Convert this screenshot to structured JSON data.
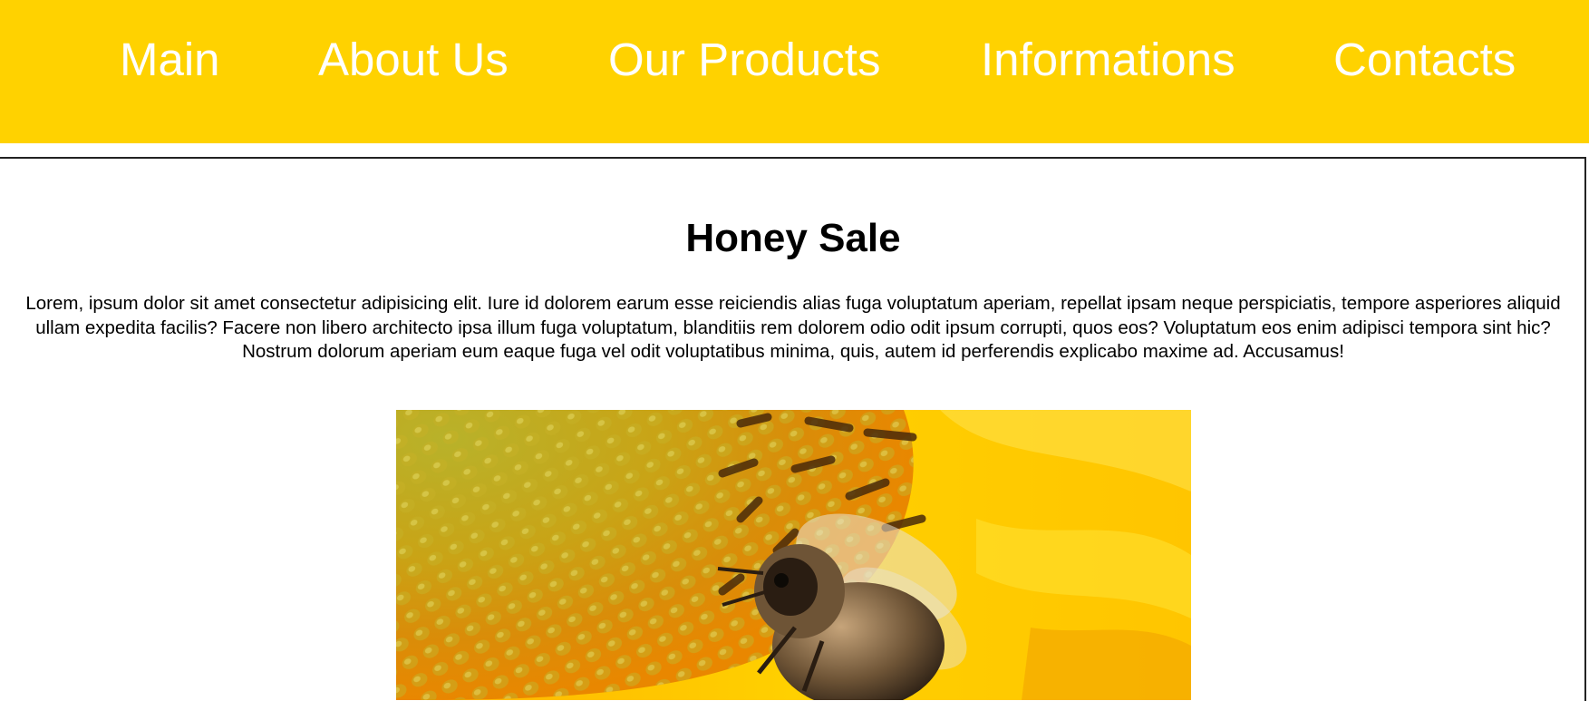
{
  "nav": {
    "items": [
      {
        "label": "Main"
      },
      {
        "label": "About Us"
      },
      {
        "label": "Our Products"
      },
      {
        "label": "Informations"
      },
      {
        "label": "Contacts"
      }
    ]
  },
  "main": {
    "title": "Honey Sale",
    "intro": "Lorem, ipsum dolor sit amet consectetur adipisicing elit. Iure id dolorem earum esse reiciendis alias fuga voluptatum aperiam, repellat ipsam neque perspiciatis, tempore asperiores aliquid ullam expedita facilis? Facere non libero architecto ipsa illum fuga voluptatum, blanditiis rem dolorem odio odit ipsum corrupti, quos eos? Voluptatum eos enim adipisci tempora sint hic? Nostrum dolorum aperiam eum eaque fuga vel odit voluptatibus minima, quis, autem id perferendis explicabo maxime ad. Accusamus!",
    "image": {
      "icon": "bee-on-sunflower-photo"
    }
  },
  "colors": {
    "nav_background": "#ffd200",
    "nav_text": "#ffffff",
    "body_background": "#ffffff",
    "text": "#000000"
  }
}
